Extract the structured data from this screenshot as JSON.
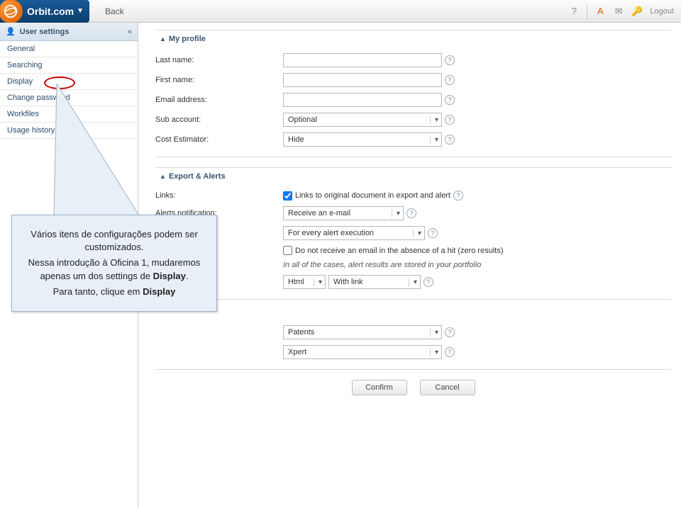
{
  "header": {
    "brand": "Orbit.com",
    "back": "Back",
    "logout": "Logout"
  },
  "sidebar": {
    "title": "User settings",
    "items": [
      {
        "label": "General"
      },
      {
        "label": "Searching"
      },
      {
        "label": "Display"
      },
      {
        "label": "Change password"
      },
      {
        "label": "Workfiles"
      },
      {
        "label": "Usage history"
      }
    ]
  },
  "profile": {
    "title": "My profile",
    "last_name_label": "Last name:",
    "last_name_value": "",
    "first_name_label": "First name:",
    "first_name_value": "",
    "email_label": "Email address:",
    "email_value": "",
    "sub_account_label": "Sub account:",
    "sub_account_value": "Optional",
    "cost_estimator_label": "Cost Estimator:",
    "cost_estimator_value": "Hide"
  },
  "export": {
    "title": "Export & Alerts",
    "links_label": "Links:",
    "links_checkbox_text": "Links to original document in export and alert",
    "alerts_label": "Alerts notification:",
    "alerts_value": "Receive an e-mail",
    "alerts_freq_value": "For every alert execution",
    "no_hit_text": "Do not receive an email in the absence of a hit (zero results)",
    "note": "In all of the cases, alert results are stored in your portfolio",
    "fmt1": "Html",
    "fmt2": "With link"
  },
  "collection": {
    "coll_value": "Patents",
    "scope_value": "Xpert"
  },
  "buttons": {
    "confirm": "Confirm",
    "cancel": "Cancel"
  },
  "callout": {
    "p1": "Vários itens de configurações podem ser customizados.",
    "p2a": "Nessa introdução à Oficina 1, mudaremos apenas um dos settings de ",
    "p2b": "Display",
    "p2c": ".",
    "p3a": "Para tanto, clique em ",
    "p3b": "Display"
  }
}
